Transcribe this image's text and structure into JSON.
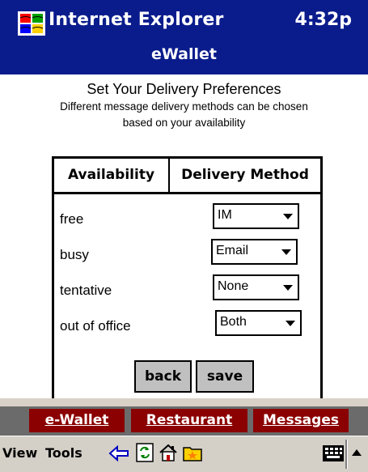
{
  "titlebar": {
    "app_name": "Internet Explorer",
    "time": "4:32p",
    "page_title": "eWallet"
  },
  "content": {
    "heading": "Set Your Delivery Preferences",
    "subheading_line1": "Different message delivery methods can be chosen",
    "subheading_line2": "based on your availability"
  },
  "table": {
    "headers": [
      "Availability",
      "Delivery Method"
    ],
    "rows": [
      {
        "availability": "free",
        "method": "IM"
      },
      {
        "availability": "busy",
        "method": "Email"
      },
      {
        "availability": "tentative",
        "method": "None"
      },
      {
        "availability": "out of office",
        "method": "Both"
      }
    ]
  },
  "buttons": {
    "back": "back",
    "save": "save"
  },
  "links": {
    "ewallet": "e-Wallet",
    "restaurant": "Restaurant",
    "messages": "Messages"
  },
  "cmdbar": {
    "view": "View",
    "tools": "Tools",
    "icons": [
      "back-arrow-icon",
      "refresh-icon",
      "home-icon",
      "favorites-icon",
      "keyboard-icon",
      "input-menu-arrow-icon"
    ]
  },
  "colors": {
    "titlebar": "#0a1c8c",
    "link_background": "#8b0000",
    "button_background": "#c0c0c0",
    "command_bar": "#d4d0c8"
  }
}
